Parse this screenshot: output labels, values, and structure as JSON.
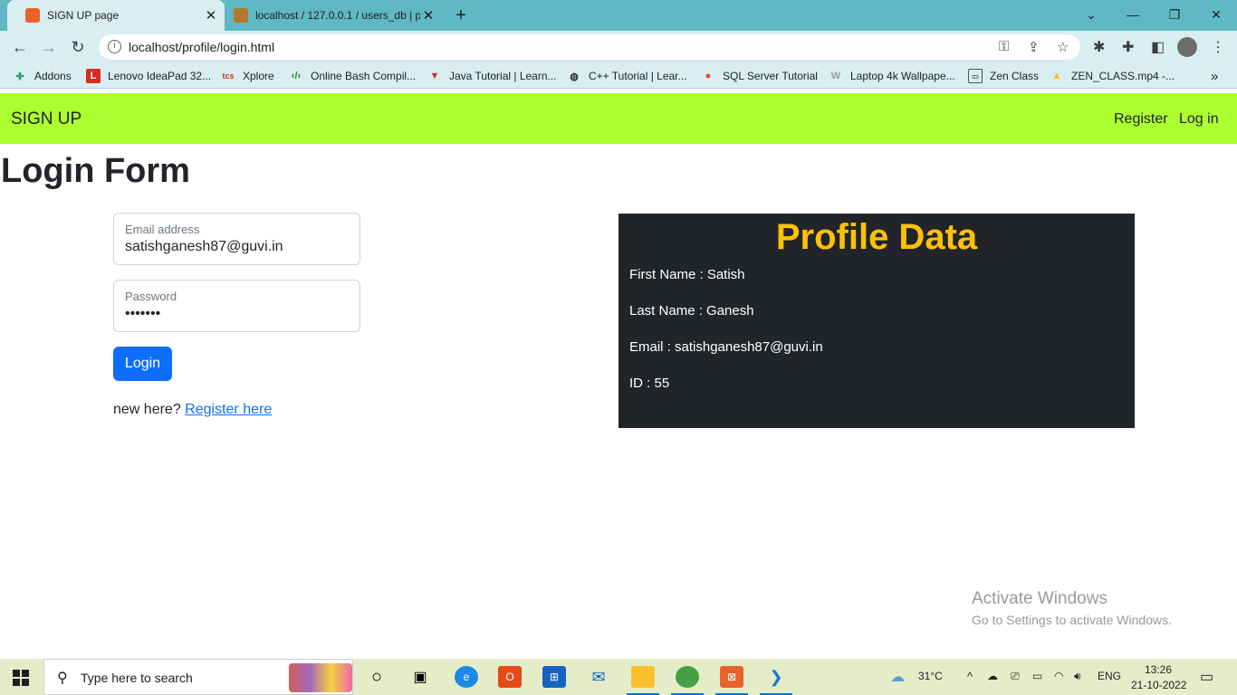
{
  "browser": {
    "tabs": [
      {
        "title": "SIGN UP page",
        "favicon_color": "#e8632a"
      },
      {
        "title": "localhost / 127.0.0.1 / users_db | p",
        "favicon_color": "#b07a2a"
      }
    ],
    "new_tab": "+",
    "url": "localhost/profile/login.html",
    "bookmarks": [
      {
        "label": "Addons",
        "icon_color": "#2e9e6b"
      },
      {
        "label": "Lenovo IdeaPad 32...",
        "icon_color": "#d62d20"
      },
      {
        "label": "Xplore",
        "icon_color": "#d62d20"
      },
      {
        "label": "Online Bash Compil...",
        "icon_color": "#2e7d32"
      },
      {
        "label": "Java Tutorial | Learn...",
        "icon_color": "#d62d20"
      },
      {
        "label": "C++ Tutorial | Lear...",
        "icon_color": "#333333"
      },
      {
        "label": "SQL Server Tutorial",
        "icon_color": "#e8432a"
      },
      {
        "label": "Laptop 4k Wallpape...",
        "icon_color": "#9e9e9e"
      },
      {
        "label": "Zen Class",
        "icon_color": "#555555"
      },
      {
        "label": "ZEN_CLASS.mp4 -...",
        "icon_color": "#fbbc04"
      }
    ],
    "more_bookmarks": "»"
  },
  "navbar": {
    "brand": "SIGN UP",
    "links": [
      "Register",
      "Log in"
    ],
    "color": "#adff2f"
  },
  "page": {
    "title": "Login Form",
    "email": {
      "label": "Email address",
      "value": "satishganesh87@guvi.in"
    },
    "password": {
      "label": "Password",
      "value": "•••••••"
    },
    "login_button": "Login",
    "register_prompt": "new here?",
    "register_link": "Register here"
  },
  "profile": {
    "title": "Profile Data",
    "lines": [
      "First Name : Satish",
      "Last Name : Ganesh",
      "Email : satishganesh87@guvi.in",
      "ID : 55"
    ]
  },
  "watermark": {
    "line1": "Activate Windows",
    "line2": "Go to Settings to activate Windows."
  },
  "taskbar": {
    "search_placeholder": "Type here to search",
    "weather": "31°C",
    "language": "ENG",
    "time": "13:26",
    "date": "21-10-2022"
  }
}
